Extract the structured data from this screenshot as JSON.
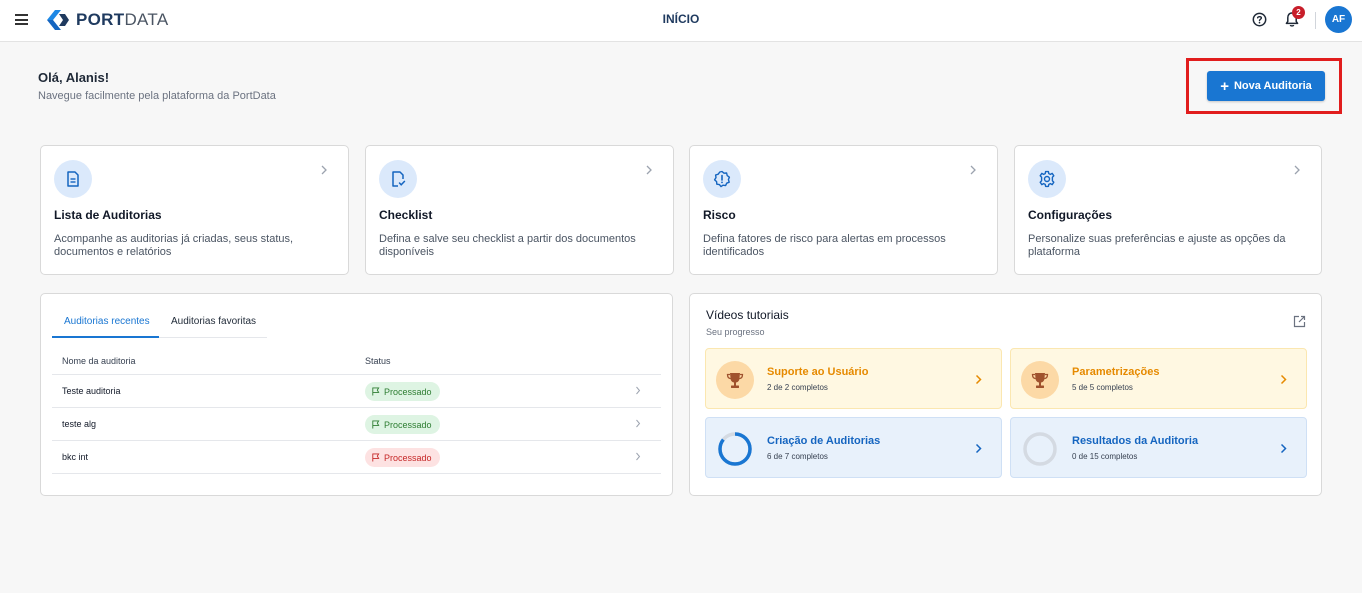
{
  "header": {
    "logo_port": "PORT",
    "logo_data": "DATA",
    "page_title": "INÍCIO",
    "notification_count": "2",
    "avatar_initials": "AF"
  },
  "greeting": {
    "title": "Olá, Alanis!",
    "subtitle": "Navegue facilmente pela plataforma da PortData"
  },
  "actions": {
    "new_audit_label": "Nova Auditoria"
  },
  "cards": [
    {
      "title": "Lista de Auditorias",
      "desc": "Acompanhe as auditorias já criadas, seus status, documentos e relatórios",
      "icon": "document-icon"
    },
    {
      "title": "Checklist",
      "desc": "Defina e salve seu checklist a partir dos documentos disponíveis",
      "icon": "file-check-icon"
    },
    {
      "title": "Risco",
      "desc": "Defina fatores de risco para alertas em processos identificados",
      "icon": "alert-badge-icon"
    },
    {
      "title": "Configurações",
      "desc": "Personalize suas preferências e ajuste as opções da plataforma",
      "icon": "gear-icon"
    }
  ],
  "audits": {
    "tabs": [
      "Auditorias recentes",
      "Auditorias favoritas"
    ],
    "active_tab": "Auditorias recentes",
    "columns": [
      "Nome da auditoria",
      "Status"
    ],
    "rows": [
      {
        "name": "Teste auditoria",
        "status": "Processado",
        "status_color": "#2e7d32"
      },
      {
        "name": "teste alg",
        "status": "Processado",
        "status_color": "#2e7d32"
      },
      {
        "name": "bkc int",
        "status": "Processado",
        "status_color": "#c62828"
      }
    ]
  },
  "videos": {
    "title": "Vídeos tutoriais",
    "subtitle": "Seu progresso",
    "items": [
      {
        "title": "Suporte ao Usuário",
        "progress": "2 de 2 completos",
        "completed": 2,
        "total": 2,
        "icon": "trophy-icon"
      },
      {
        "title": "Parametrizações",
        "progress": "5 de 5 completos",
        "completed": 5,
        "total": 5,
        "icon": "trophy-icon"
      },
      {
        "title": "Criação de Auditorias",
        "progress": "6 de 7 completos",
        "completed": 6,
        "total": 7,
        "icon": "progress-ring-icon"
      },
      {
        "title": "Resultados da Auditoria",
        "progress": "0 de 15 completos",
        "completed": 0,
        "total": 15,
        "icon": "progress-ring-icon"
      }
    ]
  },
  "colors": {
    "primary": "#1976d2",
    "highlight_border": "#e11d1d",
    "success": "#2e7d32",
    "danger": "#c62828",
    "warning": "#e68a00"
  }
}
